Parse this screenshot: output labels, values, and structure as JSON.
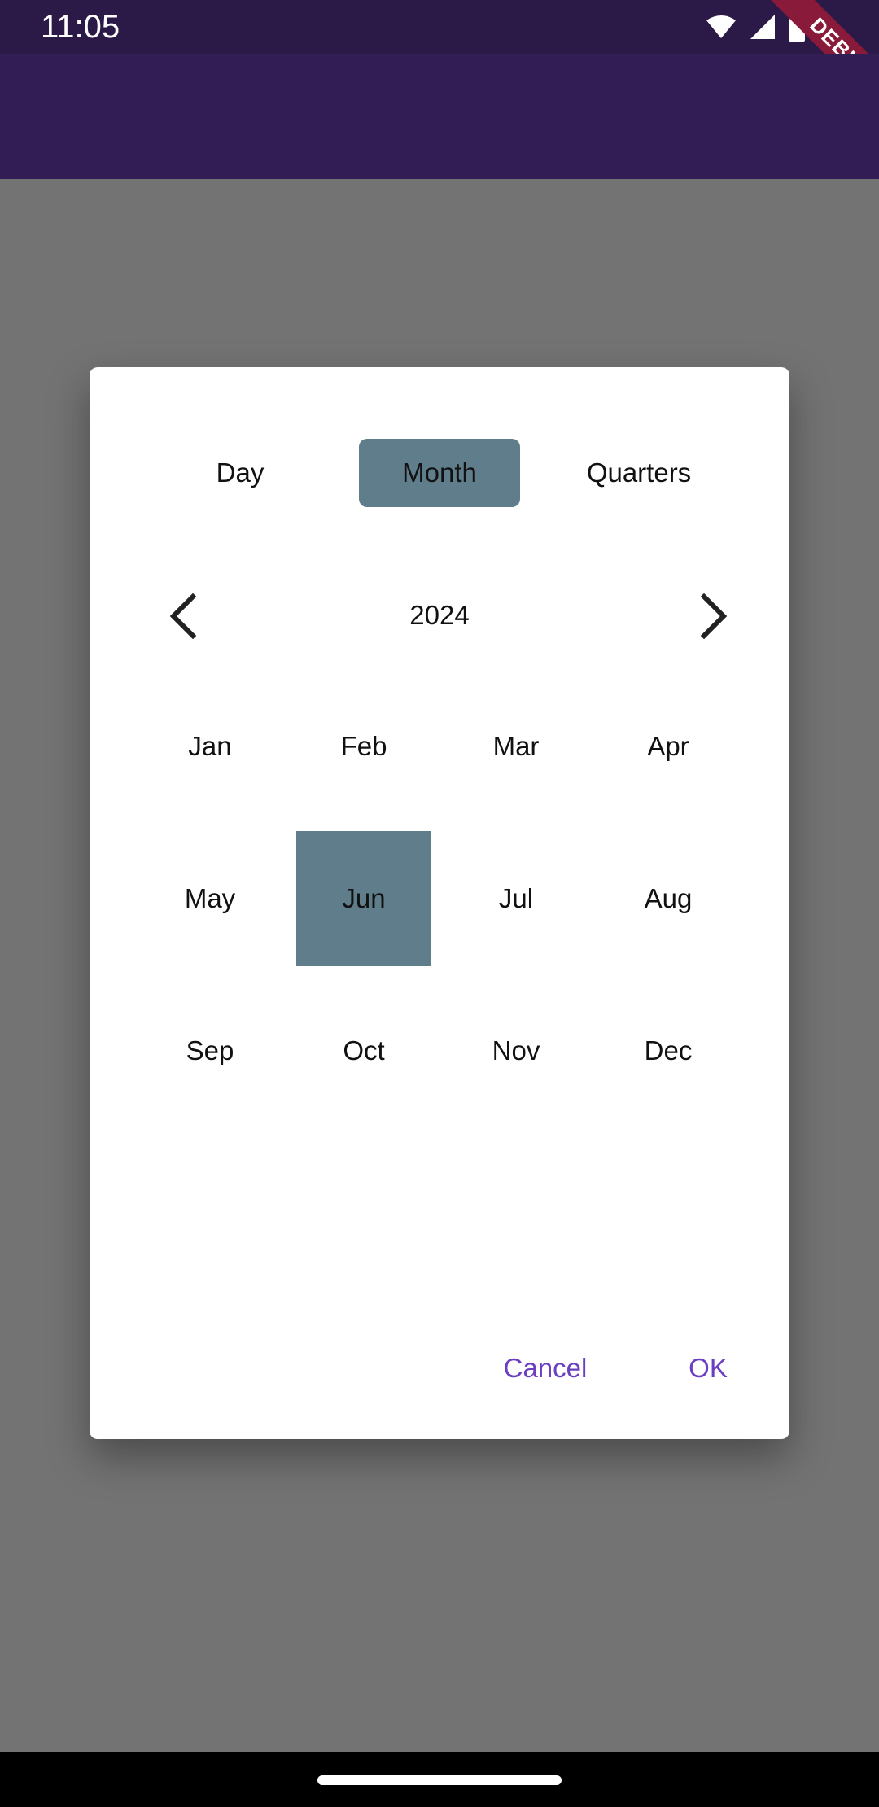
{
  "status_bar": {
    "time": "11:05",
    "icons": [
      "wifi-icon",
      "signal-icon",
      "battery-icon"
    ]
  },
  "debug_banner": "DEBUG",
  "dialog": {
    "tabs": [
      {
        "label": "Day",
        "selected": false
      },
      {
        "label": "Month",
        "selected": true
      },
      {
        "label": "Quarters",
        "selected": false
      }
    ],
    "year": "2024",
    "months": [
      "Jan",
      "Feb",
      "Mar",
      "Apr",
      "May",
      "Jun",
      "Jul",
      "Aug",
      "Sep",
      "Oct",
      "Nov",
      "Dec"
    ],
    "selected_month": "Jun",
    "actions": {
      "cancel": "Cancel",
      "ok": "OK"
    }
  },
  "colors": {
    "status_bar": "#2b1a47",
    "app_bar": "#331d55",
    "scrim": "#737373",
    "selection": "#607d8b",
    "action_text": "#6a3fc2",
    "debug_ribbon": "#8a1a3a"
  }
}
